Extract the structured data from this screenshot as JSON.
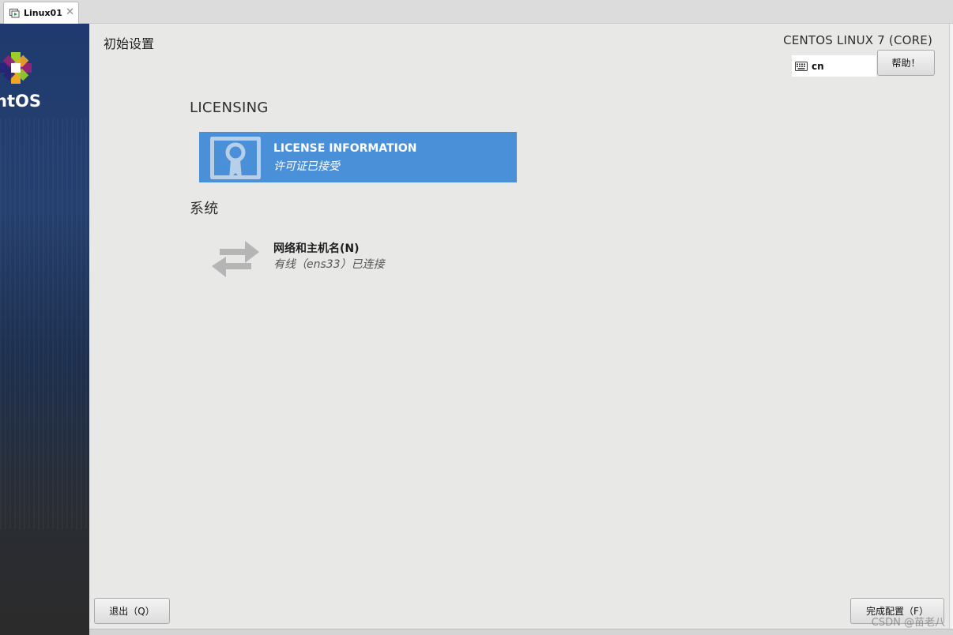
{
  "vm_tab": {
    "label": "Linux01",
    "close": "✕"
  },
  "sidebar": {
    "brand_text": "ntOS"
  },
  "header": {
    "page_title": "初始设置",
    "product_name": "CENTOS LINUX 7 (CORE)",
    "keyboard_layout": "cn",
    "help_label": "帮助！"
  },
  "sections": [
    {
      "title": "LICENSING",
      "spokes": [
        {
          "title": "LICENSE INFORMATION",
          "status": "许可证已接受",
          "icon": "license-icon"
        }
      ]
    },
    {
      "title": "系统",
      "spokes": [
        {
          "title": "网络和主机名(N)",
          "status": "有线（ens33）已连接",
          "icon": "network-icon"
        }
      ]
    }
  ],
  "footer": {
    "quit_label": "退出（Q）",
    "finish_label": "完成配置（F）"
  },
  "watermark": "CSDN @苗老八",
  "colors": {
    "selected_spoke": "#4a90d9",
    "background": "#e8e8e7",
    "sidebar_top": "#1f3a6e"
  }
}
